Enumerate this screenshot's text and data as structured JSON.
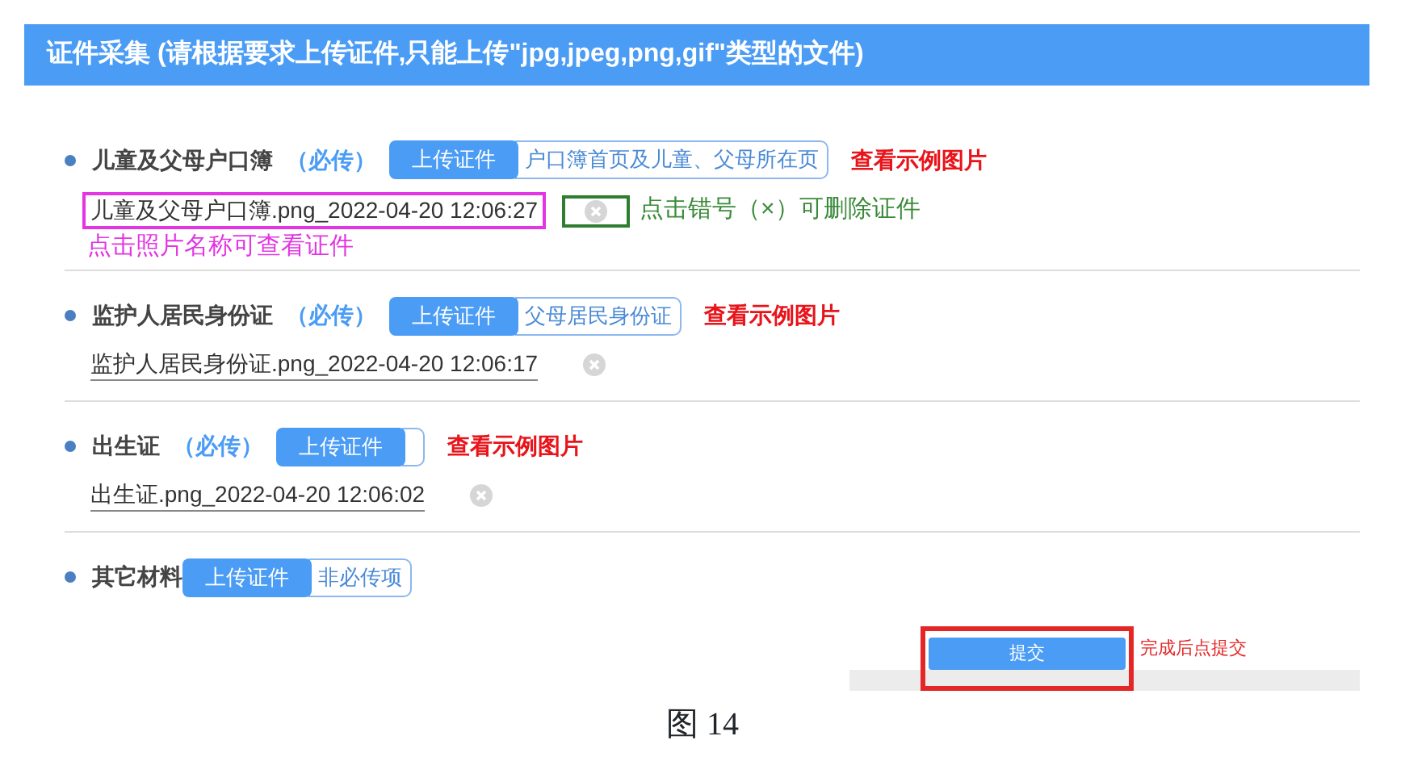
{
  "header": {
    "title": "证件采集 (请根据要求上传证件,只能上传\"jpg,jpeg,png,gif\"类型的文件)"
  },
  "items": [
    {
      "title": "儿童及父母户口簿",
      "required": "（必传）",
      "upload_button": "上传证件",
      "hint": "户口簿首页及儿童、父母所在页",
      "example_link": "查看示例图片",
      "file": "儿童及父母户口簿.png_2022-04-20 12:06:27",
      "file_note": "点击照片名称可查看证件",
      "delete_note": "点击错号（×）可删除证件"
    },
    {
      "title": "监护人居民身份证",
      "required": "（必传）",
      "upload_button": "上传证件",
      "hint": "父母居民身份证",
      "example_link": "查看示例图片",
      "file": "监护人居民身份证.png_2022-04-20 12:06:17"
    },
    {
      "title": "出生证",
      "required": "（必传）",
      "upload_button": "上传证件",
      "example_link": "查看示例图片",
      "file": "出生证.png_2022-04-20 12:06:02"
    },
    {
      "title": "其它材料",
      "upload_button": "上传证件",
      "hint": "非必传项"
    }
  ],
  "submit": {
    "label": "提交",
    "note": "完成后点提交"
  },
  "caption": "图 14"
}
